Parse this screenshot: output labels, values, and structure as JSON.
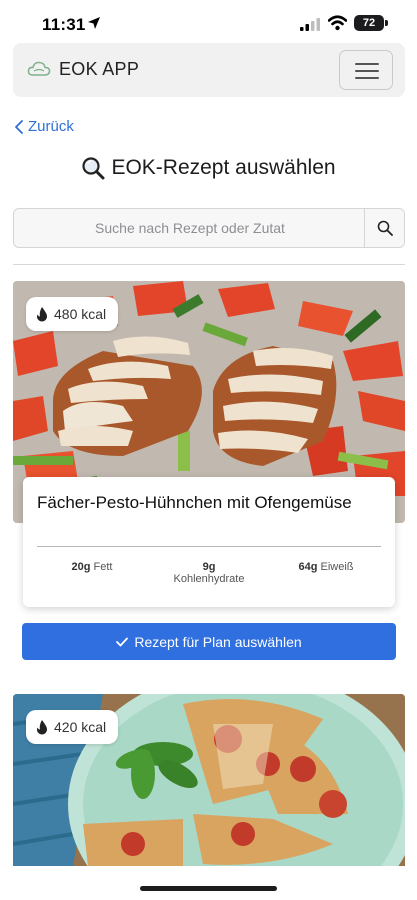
{
  "status_bar": {
    "time": "11:31",
    "battery": "72"
  },
  "navbar": {
    "brand": "EOK APP",
    "brand_icon": "cloud-icon",
    "menu_icon": "hamburger-icon"
  },
  "back": {
    "label": "Zurück"
  },
  "page": {
    "title": "EOK-Rezept auswählen",
    "title_icon": "magnifier-emoji-icon"
  },
  "search": {
    "placeholder": "Suche nach Rezept oder Zutat",
    "value": ""
  },
  "recipes": [
    {
      "kcal": "480 kcal",
      "title": "Fächer-Pesto-Hühnchen mit Ofengemüse",
      "macros": [
        {
          "value": "20g",
          "label": "Fett"
        },
        {
          "value": "9g",
          "label": "Kohlenhydrate"
        },
        {
          "value": "64g",
          "label": "Eiweiß"
        }
      ],
      "select_label": "Rezept für Plan auswählen"
    },
    {
      "kcal": "420 kcal"
    }
  ],
  "colors": {
    "accent": "#2f6fe0",
    "link": "#2f6fd8",
    "navbar_bg": "#f1f1f1"
  }
}
